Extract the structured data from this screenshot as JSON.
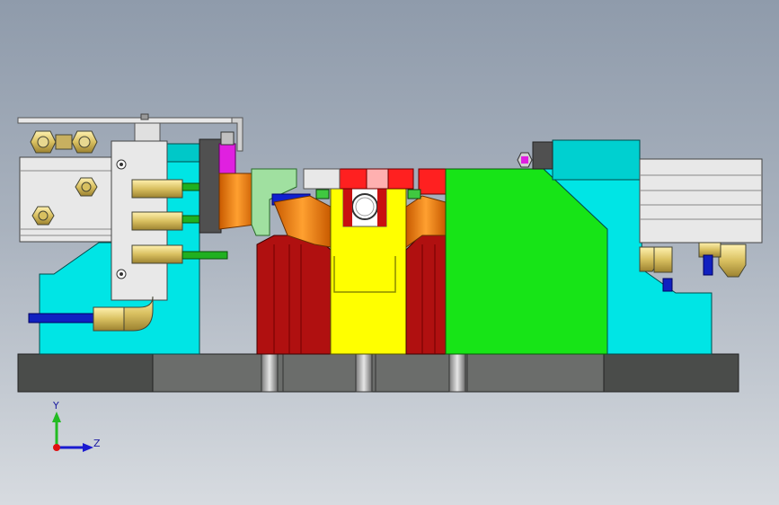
{
  "viewport": {
    "background_top": "#8f9bab",
    "background_bottom": "#d7dbe0"
  },
  "model": {
    "colors": {
      "base_plate": "#4a4c4a",
      "base_plate_light": "#6b6d6b",
      "cyan_block": "#00e5e5",
      "green_block": "#17e417",
      "yellow_block": "#ffff00",
      "red_jaw": "#b01010",
      "orange_wedge": "#e87a10",
      "brass_fitting": "#d8c060",
      "blue_pipe": "#1020c0",
      "silver_cylinder": "#e8e8e8",
      "magenta_part": "#e020e0"
    }
  },
  "triad": {
    "y_label": "Y",
    "z_label": "Z",
    "y_color": "#22bb22",
    "z_color": "#1a1ad0",
    "origin_color": "#e01010"
  }
}
